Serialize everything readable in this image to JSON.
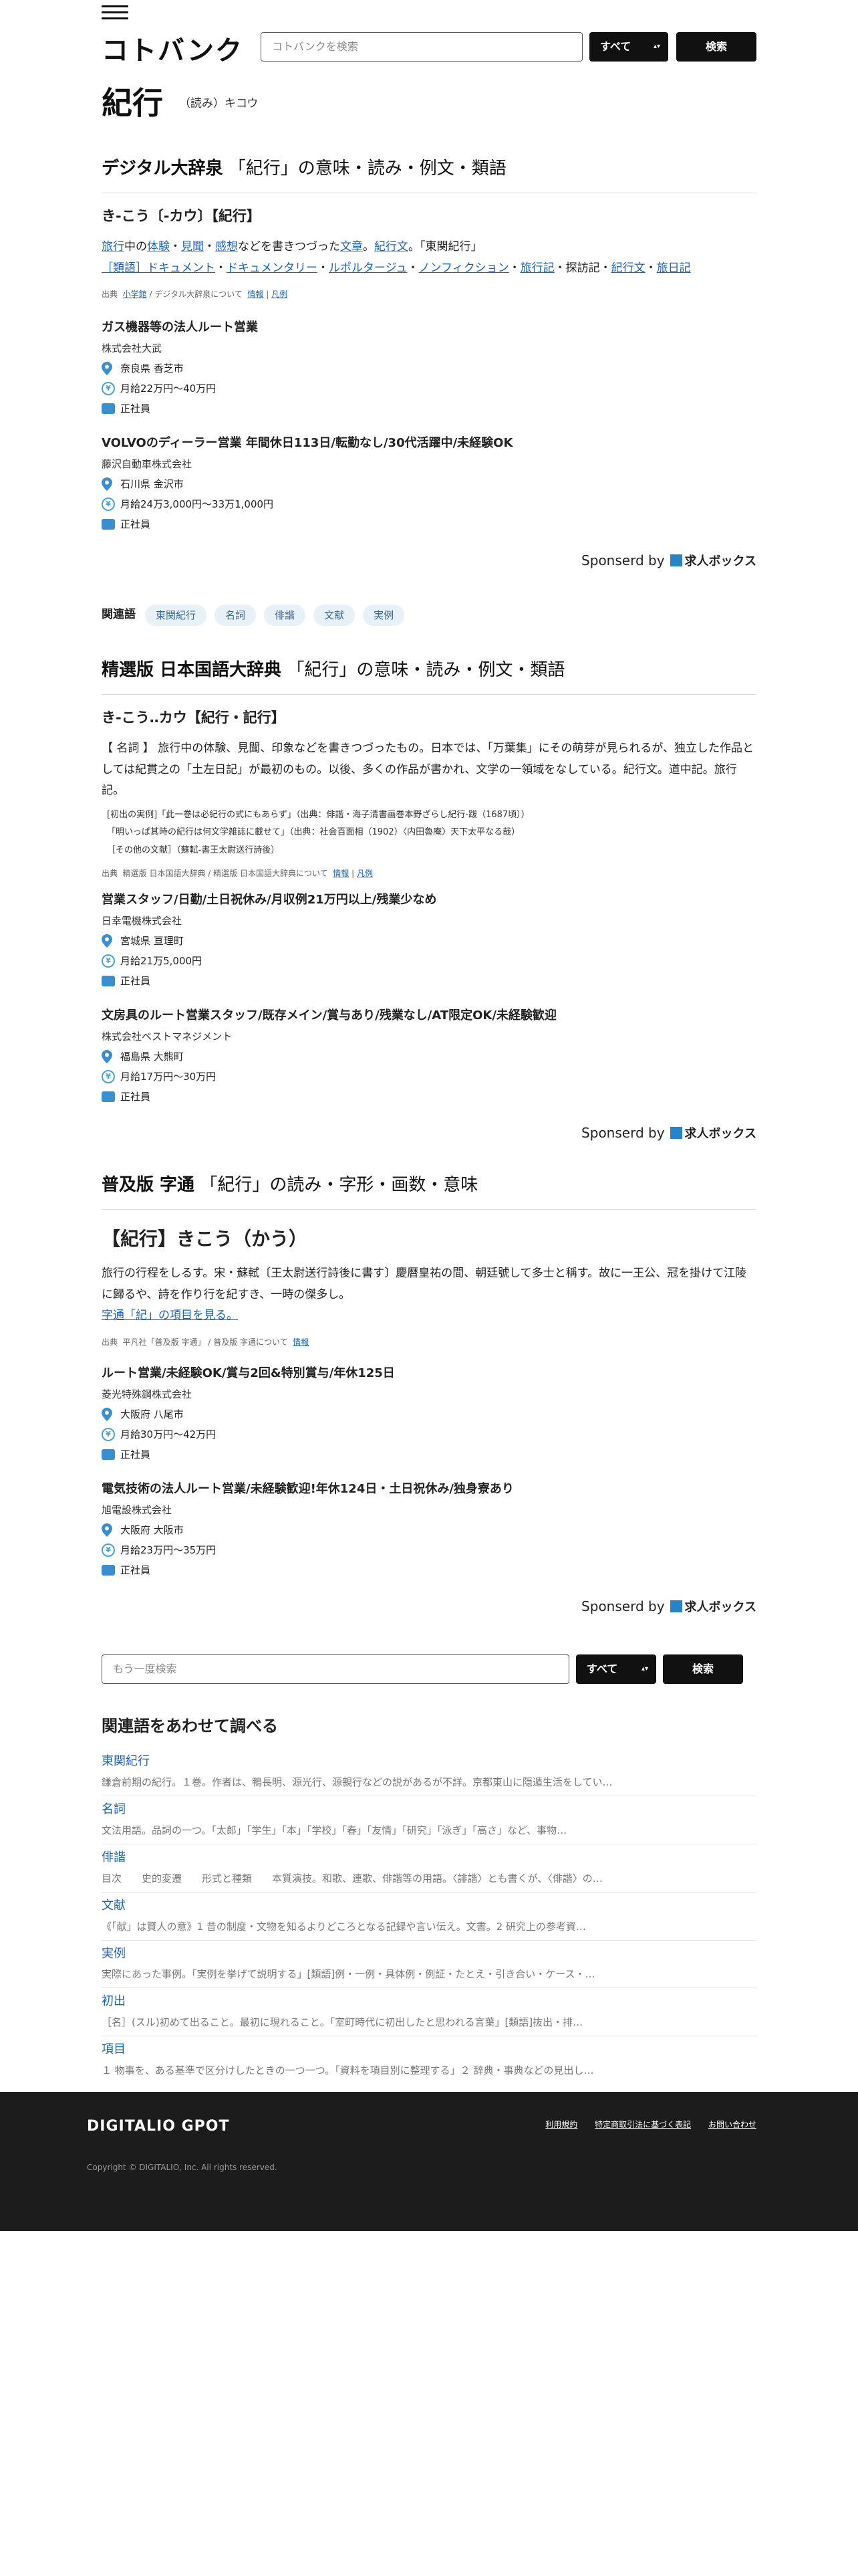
{
  "header": {
    "logo": "コトバンク",
    "search_placeholder": "コトバンクを検索",
    "scope": "すべて",
    "search_button": "検索"
  },
  "title": {
    "word": "紀行",
    "reading": "（読み）キコウ"
  },
  "sections": {
    "s1": {
      "dict": "デジタル大辞泉",
      "sub": "「紀行」の意味・読み・例文・類語",
      "entry": "き‐こう〔‐カウ〕【紀行】",
      "body_links": [
        "旅行",
        "体験",
        "見聞",
        "感想",
        "文章",
        "紀行文"
      ],
      "body_text": [
        "中の",
        "・",
        "・",
        "などを書きつづった",
        "。",
        "。「東関紀行」"
      ],
      "ruigo_label": "［類語］",
      "ruigo_links": [
        "ドキュメント",
        "ドキュメンタリー",
        "ルポルタージュ",
        "ノンフィクション",
        "旅行記",
        "紀行文",
        "旅日記"
      ],
      "ruigo_plain": "探訪記",
      "source": [
        "出典",
        "小学館",
        "デジタル大辞泉について",
        "情報",
        "凡例"
      ]
    },
    "s2": {
      "dict": "精選版 日本国語大辞典",
      "sub": "「紀行」の意味・読み・例文・類語",
      "entry": "き‐こう‥カウ【紀行・記行】",
      "body": "【 名詞 】 旅行中の体験、見聞、印象などを書きつづったもの。日本では、「万葉集」にその萌芽が見られるが、独立した作品としては紀貫之の「土左日記」が最初のもの。以後、多くの作品が書かれ、文学の一領域をなしている。紀行文。道中記。旅行記。",
      "ex1": "[初出の実例]「此一巻は必紀行の式にもあらず」（出典：俳諧・海子清書画巻本野ざらし紀行‐跋（1687頃））",
      "ex2": "「明いっぱ其時の紀行は何文学雑誌に載せて」（出典：社会百面相（1902）〈内田魯庵〉天下太平なる哉）",
      "ex3": "［その他の文献］（蘇軾‐書王太尉送行詩後）",
      "source": [
        "出典",
        "精選版 日本国語大辞典",
        "精選版 日本国語大辞典について",
        "情報",
        "凡例"
      ]
    },
    "s3": {
      "dict": "普及版 字通",
      "sub": "「紀行」の読み・字形・画数・意味",
      "entry": "【紀行】きこう（かう）",
      "body": "旅行の行程をしるす。宋・蘇軾〔王太尉送行詩後に書す〕慶暦皇祐の間、朝廷號して多士と稱す。故に一王公、冠を掛けて江陵に歸るや、詩を作り行を紀すき、一時の傑多し。",
      "link": "字通「紀」の項目を見る。",
      "source": [
        "出典",
        "平凡社「普及版 字通」",
        "普及版 字通について",
        "情報"
      ]
    }
  },
  "jobs": [
    {
      "title": "ガス機器等の法人ルート営業",
      "company": "株式会社大武",
      "location": "奈良県 香芝市",
      "salary": "月給22万円〜40万円",
      "type": "正社員"
    },
    {
      "title": "VOLVOのディーラー営業 年間休日113日/転勤なし/30代活躍中/未経験OK",
      "company": "藤沢自動車株式会社",
      "location": "石川県 金沢市",
      "salary": "月給24万3,000円〜33万1,000円",
      "type": "正社員"
    },
    {
      "title": "営業スタッフ/日勤/土日祝休み/月収例21万円以上/残業少なめ",
      "company": "日幸電機株式会社",
      "location": "宮城県 亘理町",
      "salary": "月給21万5,000円",
      "type": "正社員"
    },
    {
      "title": "文房具のルート営業スタッフ/既存メイン/賞与あり/残業なし/AT限定OK/未経験歓迎",
      "company": "株式会社ベストマネジメント",
      "location": "福島県 大熊町",
      "salary": "月給17万円〜30万円",
      "type": "正社員"
    },
    {
      "title": "ルート営業/未経験OK/賞与2回&特別賞与/年休125日",
      "company": "菱光特殊鋼株式会社",
      "location": "大阪府 八尾市",
      "salary": "月給30万円〜42万円",
      "type": "正社員"
    },
    {
      "title": "電気技術の法人ルート営業/未経験歓迎!年休124日・土日祝休み/独身寮あり",
      "company": "旭電設株式会社",
      "location": "大阪府 大阪市",
      "salary": "月給23万円〜35万円",
      "type": "正社員"
    }
  ],
  "sponsor": {
    "label": "Sponserd by",
    "brand": "求人ボックス"
  },
  "related_tags": {
    "label": "関連語",
    "items": [
      "東関紀行",
      "名詞",
      "俳諧",
      "文献",
      "実例"
    ]
  },
  "search2": {
    "placeholder": "もう一度検索",
    "scope": "すべて",
    "button": "検索"
  },
  "related_list": {
    "title": "関連語をあわせて調べる",
    "items": [
      {
        "t": "東関紀行",
        "d": "鎌倉前期の紀行。１巻。作者は、鴨長明、源光行、源親行などの説があるが不詳。京都東山に隠遁生活をしてい…"
      },
      {
        "t": "名詞",
        "d": "文法用語。品詞の一つ。「太郎」「学生」「本」「学校」「春」「友情」「研究」「泳ぎ」「高さ」など、事物…"
      },
      {
        "t": "俳諧",
        "d": "目次　　史的変遷　　形式と種類　　本質演技。和歌、連歌、俳諧等の用語。〈誹諧〉とも書くが、〈俳諧〉の…"
      },
      {
        "t": "文献",
        "d": "《「献」は賢人の意》1 昔の制度・文物を知るよりどころとなる記録や言い伝え。文書。2 研究上の参考資…"
      },
      {
        "t": "実例",
        "d": "実際にあった事例。「実例を挙げて説明する」[類語]例・一例・具体例・例証・たとえ・引き合い・ケース・…"
      },
      {
        "t": "初出",
        "d": "［名］(スル)初めて出ること。最初に現れること。「室町時代に初出したと思われる言葉」[類語]抜出・排…"
      },
      {
        "t": "項目",
        "d": "１ 物事を、ある基準で区分けしたときの一つ一つ。「資料を項目別に整理する」２ 辞典・事典などの見出し…"
      }
    ]
  },
  "footer": {
    "logo": "DIGITALIO GPOT",
    "links": [
      "利用規約",
      "特定商取引法に基づく表記",
      "お問い合わせ"
    ],
    "copyright": "Copyright © DIGITALIO, Inc. All rights reserved."
  }
}
